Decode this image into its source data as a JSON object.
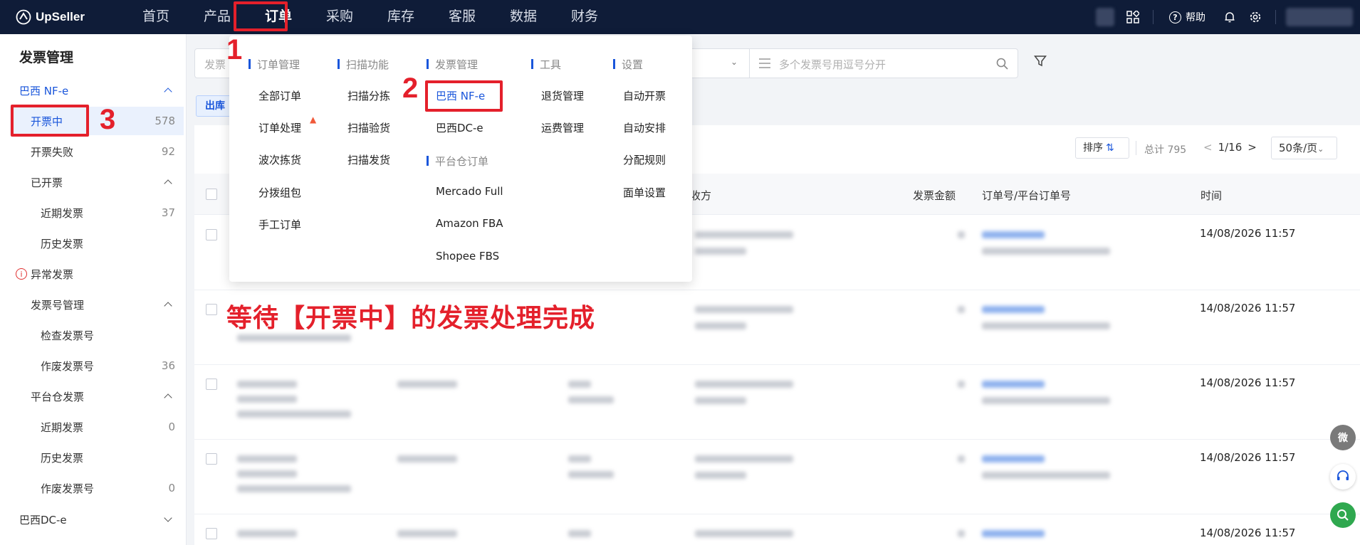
{
  "app": {
    "name": "UpSeller"
  },
  "nav": {
    "items": [
      "首页",
      "产品",
      "订单",
      "采购",
      "库存",
      "客服",
      "数据",
      "财务"
    ],
    "help_label": "帮助"
  },
  "sidebar": {
    "title": "发票管理",
    "group_nfe": "巴西 NF-e",
    "issuing": {
      "label": "开票中",
      "count": "578"
    },
    "failed": {
      "label": "开票失败",
      "count": "92"
    },
    "issued": "已开票",
    "issued_recent": {
      "label": "近期发票",
      "count": "37"
    },
    "issued_history": "历史发票",
    "abnormal": "异常发票",
    "number_mgmt": "发票号管理",
    "check_numbers": "检查发票号",
    "void_numbers": {
      "label": "作废发票号",
      "count": "36"
    },
    "platform_invoices": "平台仓发票",
    "platform_recent": {
      "label": "近期发票",
      "count": "0"
    },
    "platform_history": "历史发票",
    "platform_void": {
      "label": "作废发票号",
      "count": "0"
    },
    "group_dce": "巴西DC-e"
  },
  "filter": {
    "placeholder": "发票",
    "search_placeholder": "多个发票号用逗号分开"
  },
  "tab_label": "出库",
  "toolbar": {
    "sort_label": "排序",
    "total": "总计 795",
    "page": "1/16",
    "page_size": "50条/页"
  },
  "table": {
    "headers": {
      "buyer": "收方",
      "amount": "发票金额",
      "order_no": "订单号/平台订单号",
      "time": "时间"
    },
    "rows": [
      {
        "time": "14/08/2026 11:57"
      },
      {
        "time": "14/08/2026 11:57"
      },
      {
        "time": "14/08/2026 11:57"
      },
      {
        "time": "14/08/2026 11:57"
      },
      {
        "time": "14/08/2026 11:57"
      }
    ]
  },
  "menu": {
    "col_orders": {
      "head": "订单管理",
      "items": [
        "全部订单",
        "订单处理",
        "波次拣货",
        "分拨组包",
        "手工订单"
      ]
    },
    "col_scan": {
      "head": "扫描功能",
      "items": [
        "扫描分拣",
        "扫描验货",
        "扫描发货"
      ]
    },
    "col_invoice": {
      "head": "发票管理",
      "items": [
        "巴西 NF-e",
        "巴西DC-e"
      ]
    },
    "col_platform": {
      "head": "平台仓订单",
      "items": [
        "Mercado Full",
        "Amazon FBA",
        "Shopee FBS"
      ]
    },
    "col_tools": {
      "head": "工具",
      "items": [
        "退货管理",
        "运费管理"
      ]
    },
    "col_settings": {
      "head": "设置",
      "items": [
        "自动开票",
        "自动安排",
        "分配规则",
        "面单设置"
      ]
    }
  },
  "annotations": {
    "step1": "1",
    "step2": "2",
    "step3": "3",
    "instruction": "等待【开票中】的发票处理完成"
  },
  "fab": {
    "wechat": "微"
  },
  "colors": {
    "nav_bg": "#0f1c38",
    "accent": "#1a56db",
    "annotation_red": "#e4202b"
  }
}
